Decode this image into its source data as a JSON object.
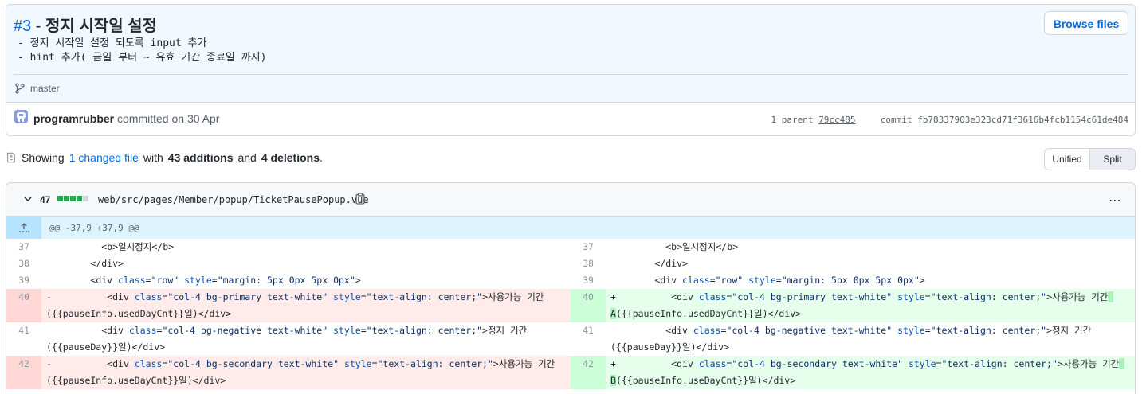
{
  "commit": {
    "number": "#3",
    "dash": " - ",
    "title": "정지 시작일 설정",
    "description": "- 정지 시작일 설정 되도록 input 추가\n- hint 추가( 금일 부터 ~ 유효 기간 종료일 까지)",
    "browse_button": "Browse files",
    "branch": "master",
    "author": "programrubber",
    "committed_text": " committed on 30 Apr",
    "parent_label": "1 parent",
    "parent_sha": "79cc485",
    "commit_label": "commit",
    "commit_sha": "fb78337903e323cd71f3616b4fcb1154c61de484"
  },
  "stats": {
    "showing": "Showing",
    "changed_files": "1 changed file",
    "with": "with",
    "additions": "43 additions",
    "and": "and",
    "deletions": "4 deletions",
    "period": "."
  },
  "view_toggle": {
    "unified": "Unified",
    "split": "Split"
  },
  "file": {
    "lines_changed": "47",
    "path": "web/src/pages/Member/popup/TicketPausePopup.vue",
    "hunk": "@@ -37,9 +37,9 @@",
    "diffstat": [
      "#2da44e",
      "#2da44e",
      "#2da44e",
      "#2da44e",
      "#d0d7de"
    ]
  },
  "rows": [
    {
      "left_num": "37",
      "right_num": "37"
    },
    {
      "left_num": "38",
      "right_num": "38"
    },
    {
      "left_num": "39",
      "right_num": "39"
    },
    {
      "left_num": "40",
      "right_num": "40"
    },
    {
      "left_num": "41",
      "right_num": "41"
    },
    {
      "left_num": "42",
      "right_num": "42"
    }
  ],
  "code": {
    "r37": "          <b>일시정지</b>",
    "r38": "        </div>",
    "r39_a": "        <div ",
    "r39_class": "class",
    "r39_b": "=",
    "r39_row": "\"row\"",
    "r39_style": " style",
    "r39_c": "=",
    "r39_sv": "\"margin: 5px 0px 5px 0px\"",
    "r39_d": ">",
    "r40_left_marker": "-",
    "r40_right_marker": "+",
    "r40_cls": "\"col-4 bg-primary text-white\"",
    "r40_text_left": ">사용가능 기간",
    "r40_tail_left": "({{pauseInfo.usedDayCnt}}일)</div>",
    "r40_text_right": ">사용가능 기간",
    "r40_tail_right": "({{pauseInfo.usedDayCnt}}일)</div>",
    "r40_added_char": "A",
    "r41_cls": "\"col-4 bg-negative text-white\"",
    "r41_text": ">정지 기간",
    "r41_tail": "({{pauseDay}}일)</div>",
    "r42_cls": "\"col-4 bg-secondary text-white\"",
    "r42_text": ">사용가능 기간",
    "r42_tail_left": "({{pauseInfo.useDayCnt}}일)</div>",
    "r42_tail_right": "({{pauseInfo.useDayCnt}}일)</div>",
    "r42_added_char": "B",
    "div_open": "<div ",
    "attr_class": "class",
    "eq": "=",
    "attr_style": " style",
    "style_val": "\"text-align: center;\"",
    "indent": "          "
  }
}
